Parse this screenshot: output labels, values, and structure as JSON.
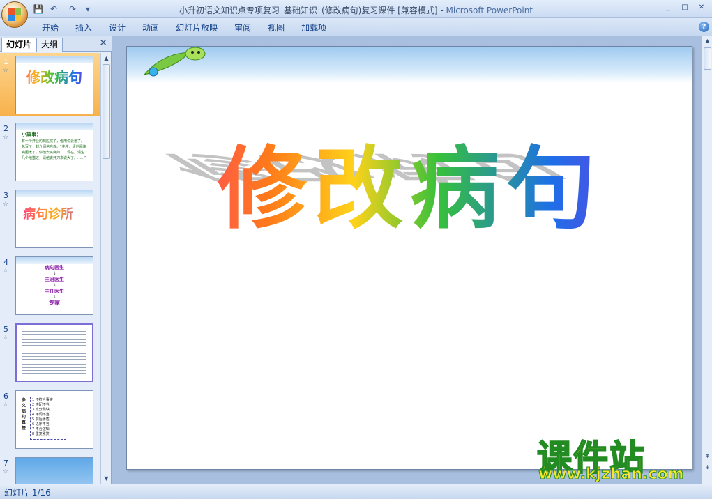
{
  "window": {
    "title": "小升初语文知识点专项复习_基础知识_(修改病句)复习课件 [兼容模式]",
    "title_sep": " - ",
    "app_name": "Microsoft PowerPoint",
    "minimize": "_",
    "maximize": "□",
    "close": "✕"
  },
  "qat": {
    "save": "💾",
    "undo": "↶",
    "redo": "↷",
    "more": "▾"
  },
  "ribbon": {
    "tabs": [
      "开始",
      "插入",
      "设计",
      "动画",
      "幻灯片放映",
      "审阅",
      "视图",
      "加载项"
    ],
    "help": "?"
  },
  "left_panel": {
    "tab_slides": "幻灯片",
    "tab_outline": "大纲",
    "close": "✕",
    "slides": [
      {
        "num": "1",
        "anim": "☆"
      },
      {
        "num": "2",
        "anim": "☆"
      },
      {
        "num": "3",
        "anim": "☆"
      },
      {
        "num": "4",
        "anim": "☆"
      },
      {
        "num": "5",
        "anim": "☆"
      },
      {
        "num": "6",
        "anim": "☆"
      },
      {
        "num": "7",
        "anim": "☆"
      }
    ],
    "scroll_up": "▲",
    "scroll_down": "▼"
  },
  "slide": {
    "title": "修改病句"
  },
  "thumb_texts": {
    "t1": "修改病句",
    "t2_head": "小故事：",
    "t2_body": "有一个开业的病医院子，但用说会道了。总写了一封介绍信自传。“先生，请他阅读病因太了，你他去买病药……现在，请生几个他描述，请他去开刀来说大了。……”",
    "t3": "病句诊所",
    "t4_lines": [
      "病句医生",
      "主治医生",
      "主任医生",
      "专家"
    ],
    "t6_side": "多义病句真签",
    "t6_lines": [
      "1 不符合事实",
      "2 搭配不当",
      "3 成分残缺",
      "4 用词不当",
      "5 前后矛盾",
      "6 语序不当",
      "7 不合逻辑",
      "8 重复累赘"
    ]
  },
  "watermark": {
    "brand": "课件站",
    "url": "www.kjzhan.com"
  },
  "workspace_nav": {
    "up": "▲",
    "prev": "⇞",
    "next": "⇟"
  },
  "status": {
    "text": "幻灯片 1/16"
  }
}
